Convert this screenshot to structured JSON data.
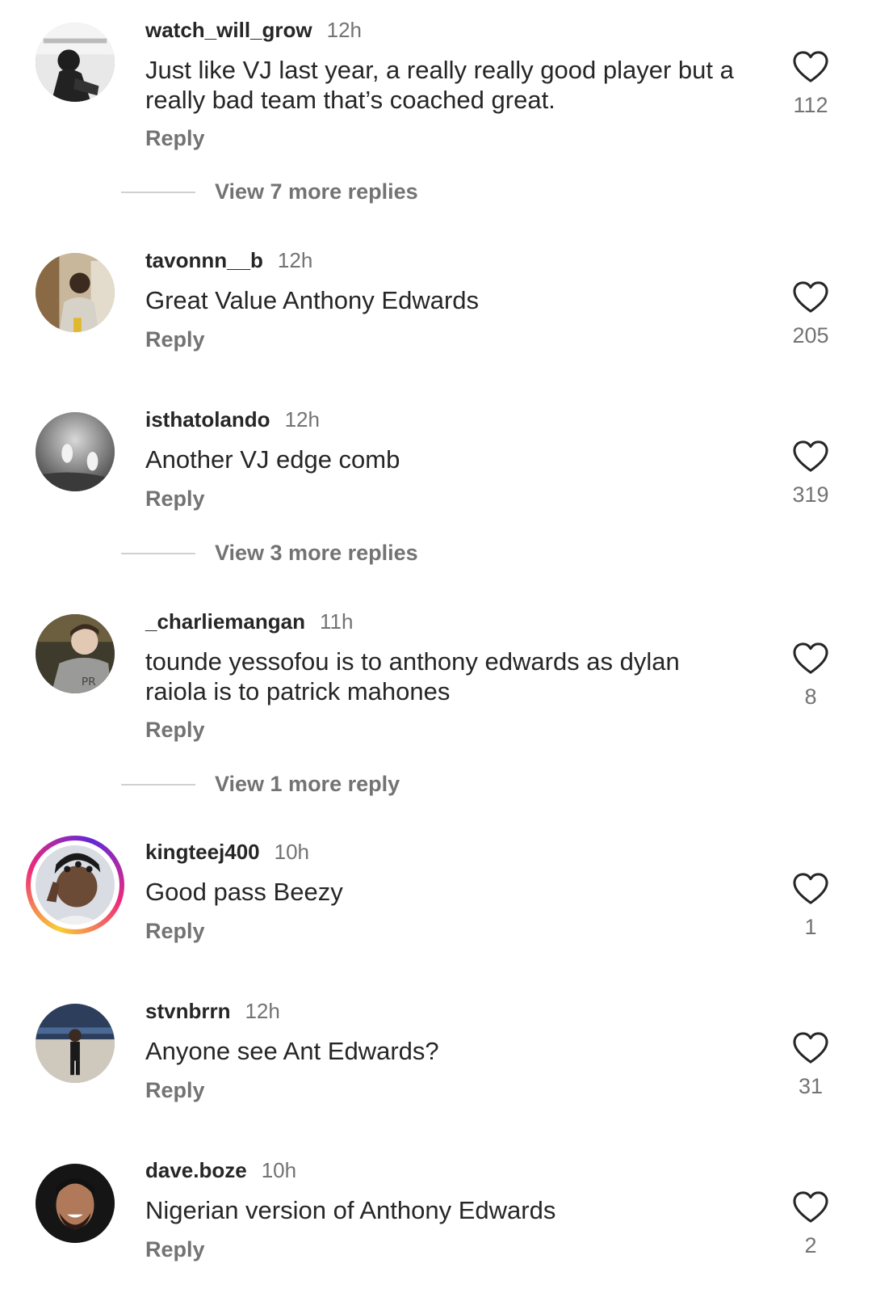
{
  "comments": [
    {
      "username": "watch_will_grow",
      "time": "12h",
      "text": "Just like VJ last year, a really really good player but a really bad team that’s coached great.",
      "reply": "Reply",
      "likes": "112"
    },
    {
      "username": "tavonnn__b",
      "time": "12h",
      "text": "Great Value Anthony Edwards",
      "reply": "Reply",
      "likes": "205"
    },
    {
      "username": "isthatolando",
      "time": "12h",
      "text": "Another VJ edge comb",
      "reply": "Reply",
      "likes": "319"
    },
    {
      "username": "_charliemangan",
      "time": "11h",
      "text": "tounde yessofou is to anthony edwards as dylan raiola is to patrick mahones",
      "reply": "Reply",
      "likes": "8"
    },
    {
      "username": "kingteej400",
      "time": "10h",
      "text": "Good pass Beezy",
      "reply": "Reply",
      "likes": "1"
    },
    {
      "username": "stvnbrrn",
      "time": "12h",
      "text": "Anyone see Ant Edwards?",
      "reply": "Reply",
      "likes": "31"
    },
    {
      "username": "dave.boze",
      "time": "10h",
      "text": "Nigerian version of Anthony Edwards",
      "reply": "Reply",
      "likes": "2"
    }
  ],
  "view_more": [
    "View 7 more replies",
    "View 3 more replies",
    "View 1 more reply"
  ]
}
